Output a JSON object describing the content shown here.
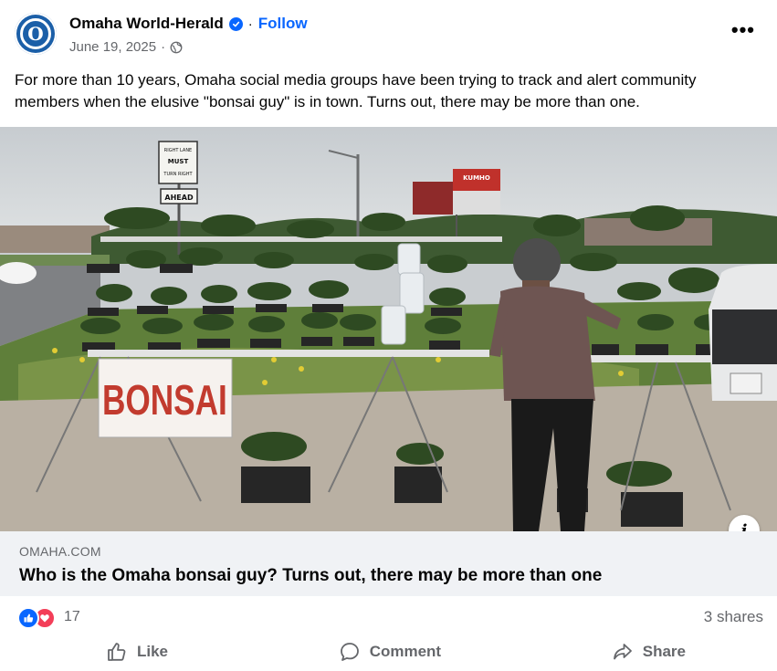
{
  "header": {
    "page_name": "Omaha World-Herald",
    "avatar_letter": "O",
    "separator": "·",
    "follow_label": "Follow",
    "date": "June 19, 2025",
    "date_separator": "·",
    "more_label": "•••"
  },
  "caption": "For more than 10 years, Omaha social media groups have been trying to track and alert community members when the elusive \"bonsai guy\" is in town. Turns out, there may be more than one.",
  "photo": {
    "sign_text": "BONSAI",
    "road_sign_lines": [
      "RIGHT LANE",
      "MUST",
      "TURN RIGHT"
    ],
    "road_sign_ahead": "AHEAD",
    "billboard_text": "KUMHO"
  },
  "link_preview": {
    "domain": "OMAHA.COM",
    "title": "Who is the Omaha bonsai guy? Turns out, there may be more than one"
  },
  "reactions": {
    "count": "17",
    "shares": "3 shares"
  },
  "actions": {
    "like": "Like",
    "comment": "Comment",
    "share": "Share"
  },
  "colors": {
    "accent": "#0866ff",
    "secondary_text": "#65676b",
    "link_bg": "#f0f2f5",
    "love": "#f33e58"
  }
}
